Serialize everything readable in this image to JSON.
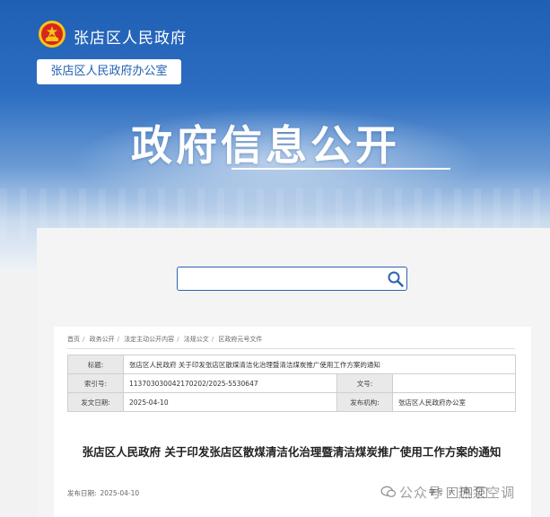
{
  "header": {
    "site_title": "张店区人民政府",
    "office_tag": "张店区人民政府办公室",
    "banner_title": "政府信息公开"
  },
  "search": {
    "placeholder": ""
  },
  "breadcrumb": [
    "首页",
    "政务公开",
    "法定主动公开内容",
    "法规公文",
    "区政府元号文件"
  ],
  "breadcrumb_sep": "/",
  "meta": {
    "label_title": "标题:",
    "title": "张店区人民政府 关于印发张店区散煤清洁化治理暨清洁煤炭推广使用工作方案的通知",
    "label_index": "索引号:",
    "index": "11370303004217020​2/2025-5530647",
    "label_doc_no": "文号:",
    "doc_no": "",
    "label_issue_date": "发文日期:",
    "issue_date": "2025-04-10",
    "label_issuer": "发布机构:",
    "issuer": "张店区人民政府办公室"
  },
  "article": {
    "title": "张店区人民政府 关于印发张店区散煤清洁化治理暨清洁煤炭推广使用工作方案的通知",
    "pub_label": "发布日期:",
    "pub_date": "2025-04-10",
    "font_label": "字号",
    "font_large": "大",
    "font_medium": "中",
    "font_small": "小"
  },
  "watermark": "公众号 · 热泵空调",
  "colors": {
    "brand": "#1f5fb4",
    "emblem_red": "#d7261e",
    "emblem_gold": "#f5c518"
  }
}
